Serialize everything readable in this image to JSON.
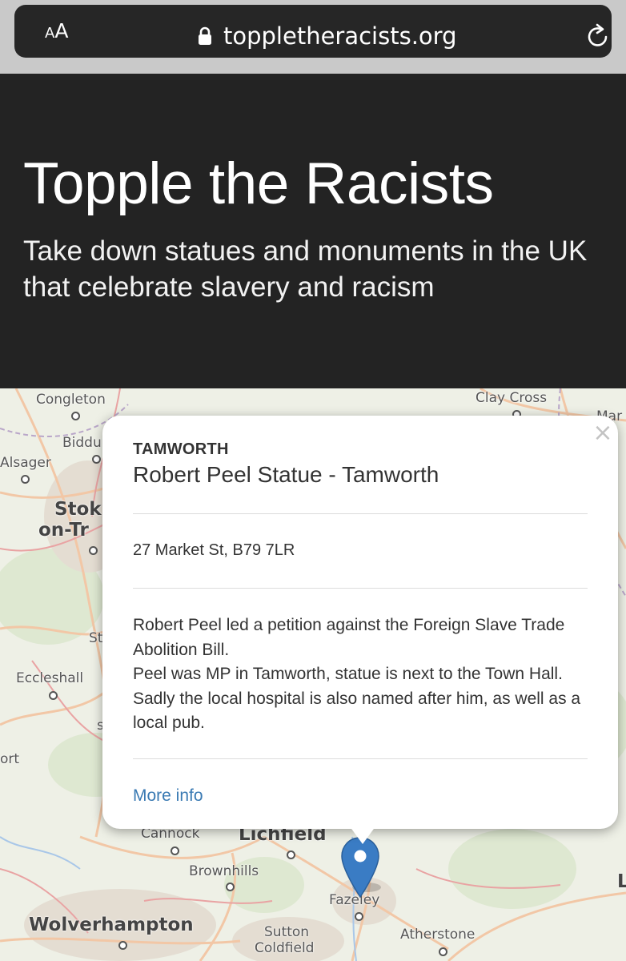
{
  "browser": {
    "text_size_small": "A",
    "text_size_large": "A",
    "url": "toppletheracists.org",
    "icons": [
      "lock-icon",
      "reload-icon"
    ]
  },
  "header": {
    "title": "Topple the Racists",
    "subtitle": "Take down statues and monuments in the UK that celebrate slavery and racism"
  },
  "map": {
    "places": {
      "congleton": "Congleton",
      "biddulph": "Biddu",
      "alsager": "Alsager",
      "stoke_1": "Stok",
      "stoke_2": "on-Tr",
      "st_partial": "St",
      "eccleshall": "Eccleshall",
      "ort_partial": "ort",
      "s_partial": "s",
      "clay_cross": "Clay Cross",
      "mar_partial": "Mar",
      "cannock": "Cannock",
      "lichfield": "Lichfield",
      "brownhills": "Brownhills",
      "fazeley": "Fazeley",
      "wolverhampton": "Wolverhampton",
      "sutton_1": "Sutton",
      "sutton_2": "Coldfield",
      "atherstone": "Atherstone",
      "l_partial": "L"
    }
  },
  "popup": {
    "close_label": "×",
    "town": "TAMWORTH",
    "name": "Robert Peel Statue - Tamworth",
    "address": "27 Market St, B79 7LR",
    "description": [
      "Robert Peel led a petition against the Foreign Slave Trade Abolition Bill.",
      "Peel was MP in Tamworth, statue is next to the Town Hall. Sadly the local hospital is also named after him, as well as a local pub."
    ],
    "more_info": "More info"
  },
  "colors": {
    "header_bg": "#232323",
    "link": "#3a7ab3",
    "marker": "#3a7cc4"
  }
}
